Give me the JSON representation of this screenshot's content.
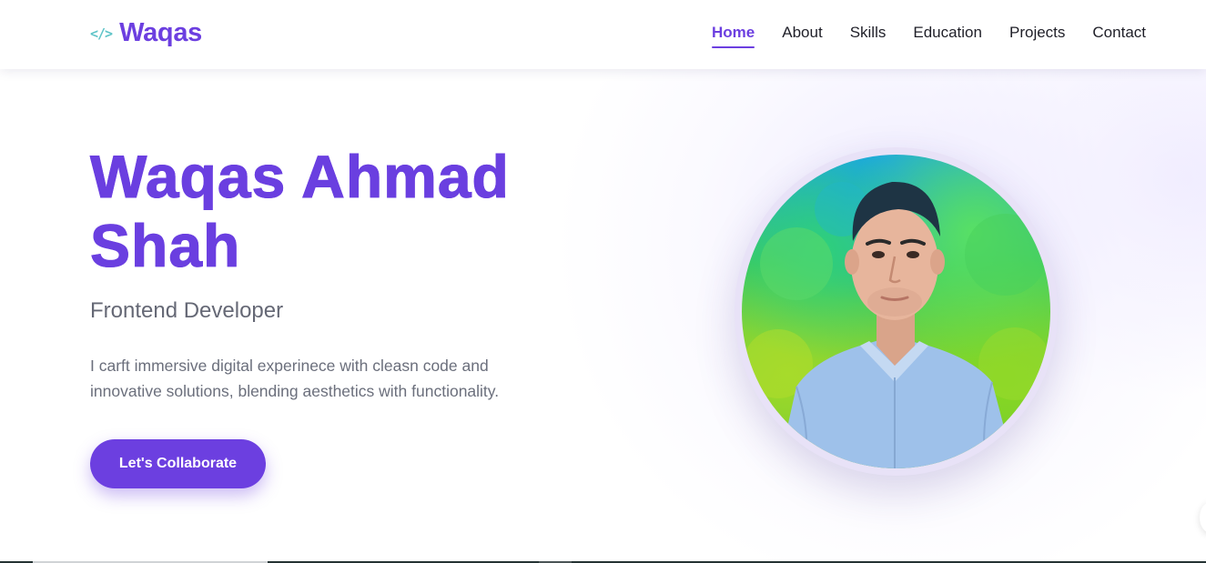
{
  "brand": {
    "icon": "</>",
    "name": "Waqas"
  },
  "nav": {
    "items": [
      {
        "label": "Home",
        "active": true
      },
      {
        "label": "About",
        "active": false
      },
      {
        "label": "Skills",
        "active": false
      },
      {
        "label": "Education",
        "active": false
      },
      {
        "label": "Projects",
        "active": false
      },
      {
        "label": "Contact",
        "active": false
      }
    ]
  },
  "hero": {
    "title_line1": "Waqas Ahmad",
    "title_line2": "Shah",
    "subtitle": "Frontend Developer",
    "description": "I carft immersive digital experinece with cleasn code and innovative solutions, blending aesthetics with functionality.",
    "cta_label": "Let's Collaborate"
  },
  "profile": {
    "photo_icon": "profile-photo"
  },
  "colors": {
    "accent": "#6c3fe0",
    "brand_icon": "#5fc4c8",
    "text_dark": "#1f1f28",
    "text_muted": "#656875"
  }
}
